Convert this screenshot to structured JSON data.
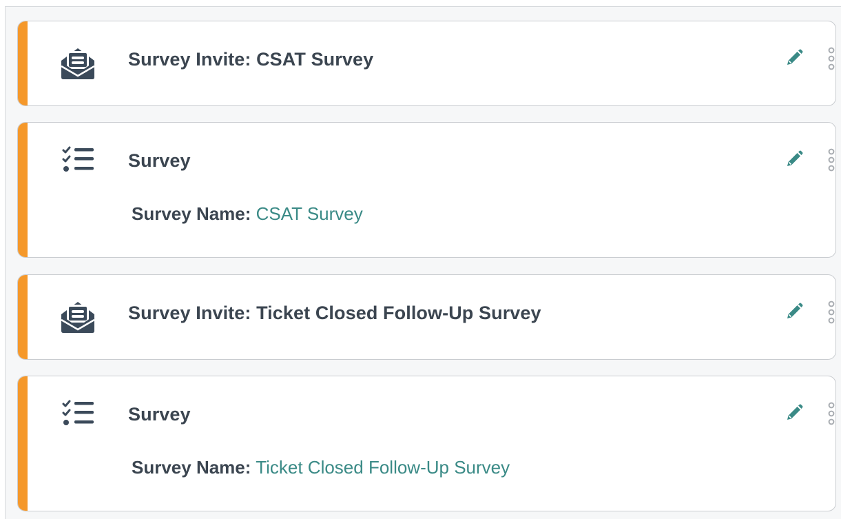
{
  "colors": {
    "accent_bar": "#f5982a",
    "icon": "#3b4a5a",
    "edit_icon": "#3a8a86",
    "link_value": "#3a8a86",
    "more_icon": "#a9adb2"
  },
  "steps": [
    {
      "icon": "envelope-open-text-icon",
      "title": "Survey Invite: CSAT Survey"
    },
    {
      "icon": "tasks-checklist-icon",
      "title": "Survey",
      "detail_label": "Survey Name:",
      "detail_value": "CSAT Survey"
    },
    {
      "icon": "envelope-open-text-icon",
      "title": "Survey Invite: Ticket Closed Follow-Up Survey"
    },
    {
      "icon": "tasks-checklist-icon",
      "title": "Survey",
      "detail_label": "Survey Name:",
      "detail_value": "Ticket Closed Follow-Up Survey"
    }
  ]
}
